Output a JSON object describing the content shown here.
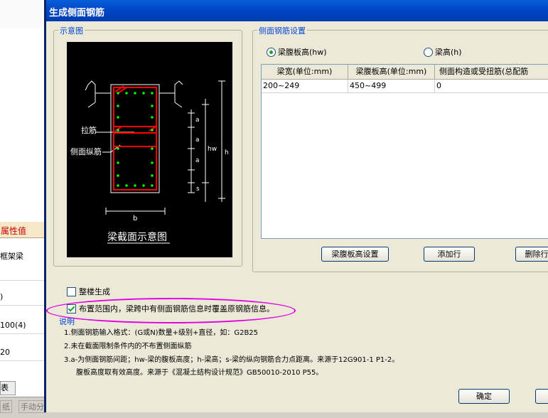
{
  "background": {
    "prop_header": "属性值",
    "rows": [
      "框架梁",
      "",
      ")",
      "100(4)",
      "20"
    ],
    "bottom_tab": "表",
    "bottom_items": [
      "纸",
      "手动分"
    ]
  },
  "dialog": {
    "title": "生成侧面钢筋",
    "diagram_group": "示意图",
    "diagram": {
      "label_tie": "拉筋",
      "label_side_rebar": "侧面纵筋",
      "label_a": "a",
      "label_hw": "hw",
      "label_h": "h",
      "label_s": "s",
      "label_b": "b",
      "caption": "梁截面示意图"
    },
    "settings_group": "侧面钢筋设置",
    "radio_web_height": "梁腹板高(hw)",
    "radio_beam_height": "梁高(h)",
    "table": {
      "headers": [
        "梁宽(单位:mm)",
        "梁腹板高(单位:mm)",
        "侧面构造或受扭筋(总配筋"
      ],
      "rows": [
        [
          "200~249",
          "450~499",
          "0"
        ]
      ]
    },
    "buttons": {
      "web_height_settings": "梁腹板高设置",
      "add_row": "添加行",
      "delete_row": "删除行",
      "ok": "确定"
    },
    "check_whole_floor": "整楼生成",
    "check_override": "布置范围内，梁跨中有侧面钢筋信息时覆盖原钢筋信息。",
    "notes_title": "说明",
    "notes": [
      "1.侧面钢筋输入格式：(G或N)数量+级别+直径，如：G2B25",
      "2.未在截面限制条件内的不布置侧面纵筋",
      "3.a-为侧面钢筋间距；hw-梁的腹板高度；h-梁高；s-梁的纵向钢筋合力点距离。来源于12G901-1 P1-2。",
      "腹板高度取有效高度。来源于《混凝土结构设计规范》GB50010-2010 P55。"
    ]
  }
}
